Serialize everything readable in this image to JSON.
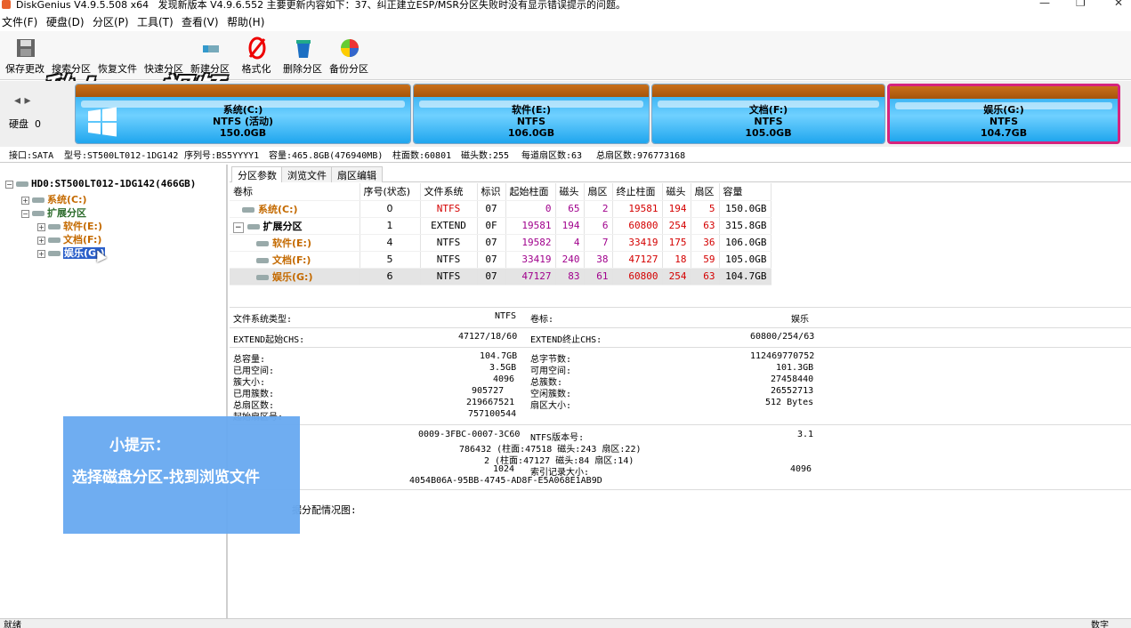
{
  "window": {
    "title": "DiskGenius V4.9.5.508 x64",
    "update_notice": "发现新版本 V4.9.6.552 主要更新内容如下：37、纠正建立ESP/MSR分区失败时没有显示错误提示的问题。",
    "controls": [
      "—",
      "❐",
      "✕"
    ]
  },
  "menu": [
    "文件(F)",
    "硬盘(D)",
    "分区(P)",
    "工具(T)",
    "查看(V)",
    "帮助(H)"
  ],
  "toolbar": [
    {
      "label": "保存更改",
      "icon": "save-icon"
    },
    {
      "label": "搜索分区",
      "icon": "search-partition-icon"
    },
    {
      "label": "恢复文件",
      "icon": "recover-file-icon"
    },
    {
      "label": "快速分区",
      "icon": "quick-partition-icon"
    },
    {
      "label": "新建分区",
      "icon": "new-partition-icon"
    },
    {
      "label": "格式化",
      "icon": "format-icon"
    },
    {
      "label": "删除分区",
      "icon": "delete-partition-icon"
    },
    {
      "label": "备份分区",
      "icon": "backup-partition-icon"
    }
  ],
  "watermark": "秒dong视频",
  "disk_label": {
    "line1": "硬盘",
    "line2": "0"
  },
  "partitions_map": [
    {
      "name": "系统(C:)",
      "fs": "NTFS (活动)",
      "size": "150.0GB"
    },
    {
      "name": "软件(E:)",
      "fs": "NTFS",
      "size": "106.0GB"
    },
    {
      "name": "文档(F:)",
      "fs": "NTFS",
      "size": "105.0GB"
    },
    {
      "name": "娱乐(G:)",
      "fs": "NTFS",
      "size": "104.7GB"
    }
  ],
  "disk_info": {
    "interface": "接口:SATA",
    "model": "型号:ST500LT012-1DG142",
    "serial": "序列号:BS5YYYY1",
    "capacity": "容量:465.8GB(476940MB)",
    "cylinders": "柱面数:60801",
    "heads": "磁头数:255",
    "sectors_per_track": "每道扇区数:63",
    "total_sectors": "总扇区数:976773168"
  },
  "tree": {
    "disk": "HD0:ST500LT012-1DG142(466GB)",
    "c": "系统(C:)",
    "extended": "扩展分区",
    "e": "软件(E:)",
    "f": "文档(F:)",
    "g": "娱乐(G:)"
  },
  "tabs": [
    "分区参数",
    "浏览文件",
    "扇区编辑"
  ],
  "table": {
    "headers": [
      "卷标",
      "序号(状态)",
      "文件系统",
      "标识",
      "起始柱面",
      "磁头",
      "扇区",
      "终止柱面",
      "磁头",
      "扇区",
      "容量"
    ],
    "rows": [
      [
        "系统(C:)",
        "0",
        "NTFS",
        "07",
        "0",
        "65",
        "2",
        "19581",
        "194",
        "5",
        "150.0GB"
      ],
      [
        "扩展分区",
        "1",
        "EXTEND",
        "0F",
        "19581",
        "194",
        "6",
        "60800",
        "254",
        "63",
        "315.8GB"
      ],
      [
        "软件(E:)",
        "4",
        "NTFS",
        "07",
        "19582",
        "4",
        "7",
        "33419",
        "175",
        "36",
        "106.0GB"
      ],
      [
        "文档(F:)",
        "5",
        "NTFS",
        "07",
        "33419",
        "240",
        "38",
        "47127",
        "18",
        "59",
        "105.0GB"
      ],
      [
        "娱乐(G:)",
        "6",
        "NTFS",
        "07",
        "47127",
        "83",
        "61",
        "60800",
        "254",
        "63",
        "104.7GB"
      ]
    ]
  },
  "details": {
    "fs_type_label": "文件系统类型:",
    "fs_type": "NTFS",
    "vol_label": "卷标:",
    "vol": "娱乐",
    "ext_start_label": "EXTEND起始CHS:",
    "ext_start": "47127/18/60",
    "ext_end_label": "EXTEND终止CHS:",
    "ext_end": "60800/254/63",
    "total_cap_label": "总容量:",
    "total_cap": "104.7GB",
    "total_bytes_label": "总字节数:",
    "total_bytes": "112469770752",
    "used_label": "已用空间:",
    "used": "3.5GB",
    "free_label": "可用空间:",
    "free": "101.3GB",
    "cluster_label": "簇大小:",
    "cluster": "4096",
    "clusters_label": "总簇数:",
    "clusters": "27458440",
    "used_clusters_label": "已用簇数:",
    "used_clusters": "905727",
    "free_clusters_label": "空闲簇数:",
    "free_clusters": "26552713",
    "total_sectors_label": "总扇区数:",
    "total_sectors": "219667521",
    "sector_size_label": "扇区大小:",
    "sector_size": "512 Bytes",
    "start_sector_label": "起始扇区号:",
    "start_sector": "757100544",
    "serial": "0009-3FBC-0007-3C60",
    "ntfs_ver_label": "NTFS版本号:",
    "ntfs_ver": "3.1",
    "mft": "786432 (柱面:47518 磁头:243 扇区:22)",
    "mftmirr": "2 (柱面:47127 磁头:84 扇区:14)",
    "record_size": "1024",
    "index_size_label": "索引记录大小:",
    "index_size": "4096",
    "guid": "4054B06A-95BB-4745-AD8F-E5A068E1AB9D",
    "alloc_label": "据分配情况图:"
  },
  "tip": {
    "title": "小提示：",
    "text": "选择磁盘分区-找到浏览文件"
  },
  "status": {
    "left": "就绪",
    "right": "数字"
  }
}
